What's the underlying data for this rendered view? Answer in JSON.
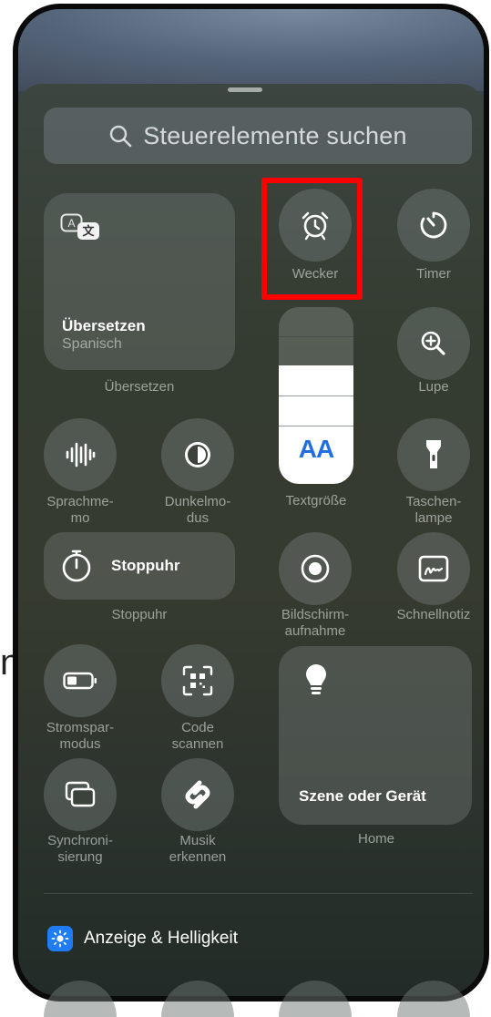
{
  "search": {
    "placeholder": "Steuerelemente suchen"
  },
  "translate": {
    "title": "Übersetzen",
    "subtitle": "Spanisch",
    "label": "Übersetzen"
  },
  "alarm": {
    "label": "Wecker"
  },
  "timer": {
    "label": "Timer"
  },
  "magnifier": {
    "label": "Lupe"
  },
  "voice_memo": {
    "label": "Sprachme-\nmo"
  },
  "dark_mode": {
    "label": "Dunkelmo-\ndus"
  },
  "text_size": {
    "label": "Textgröße",
    "glyph": "AA",
    "level": 0.67
  },
  "flashlight": {
    "label": "Taschen-\nlampe"
  },
  "stopwatch": {
    "title": "Stoppuhr",
    "label": "Stoppuhr"
  },
  "screen_recording": {
    "label": "Bildschirm-\naufnahme"
  },
  "quick_note": {
    "label": "Schnellnotiz"
  },
  "low_power": {
    "label": "Stromspar-\nmodus"
  },
  "code_scanner": {
    "label": "Code\nscannen"
  },
  "home": {
    "title": "Szene oder Gerät",
    "label": "Home"
  },
  "mirroring": {
    "label": "Synchroni-\nsierung"
  },
  "shazam": {
    "label": "Musik\nerkennen"
  },
  "display_section": {
    "label": "Anzeige & Helligkeit"
  },
  "partial_text": "n",
  "colors": {
    "highlight": "#ff0000",
    "section_icon": "#1f7cf4"
  }
}
